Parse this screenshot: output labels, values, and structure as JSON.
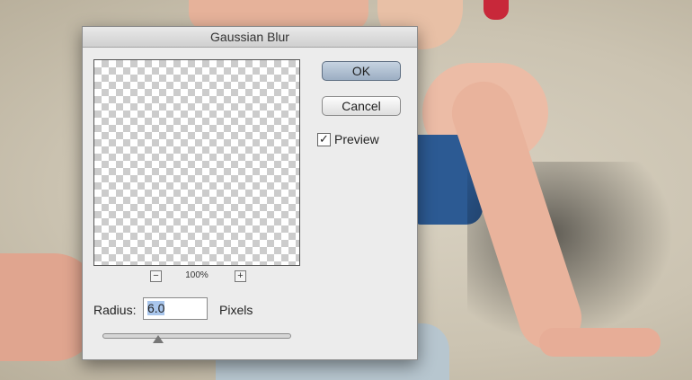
{
  "dialog": {
    "title": "Gaussian Blur",
    "ok_label": "OK",
    "cancel_label": "Cancel",
    "preview_label": "Preview",
    "preview_checked": true,
    "zoom": {
      "zoom_out_icon": "minus-icon",
      "zoom_in_icon": "plus-icon",
      "level": "100%",
      "minus_glyph": "−",
      "plus_glyph": "+"
    },
    "radius": {
      "label": "Radius:",
      "value": "6.0",
      "units": "Pixels",
      "slider_fraction": 0.33
    },
    "check_glyph": "✓"
  }
}
